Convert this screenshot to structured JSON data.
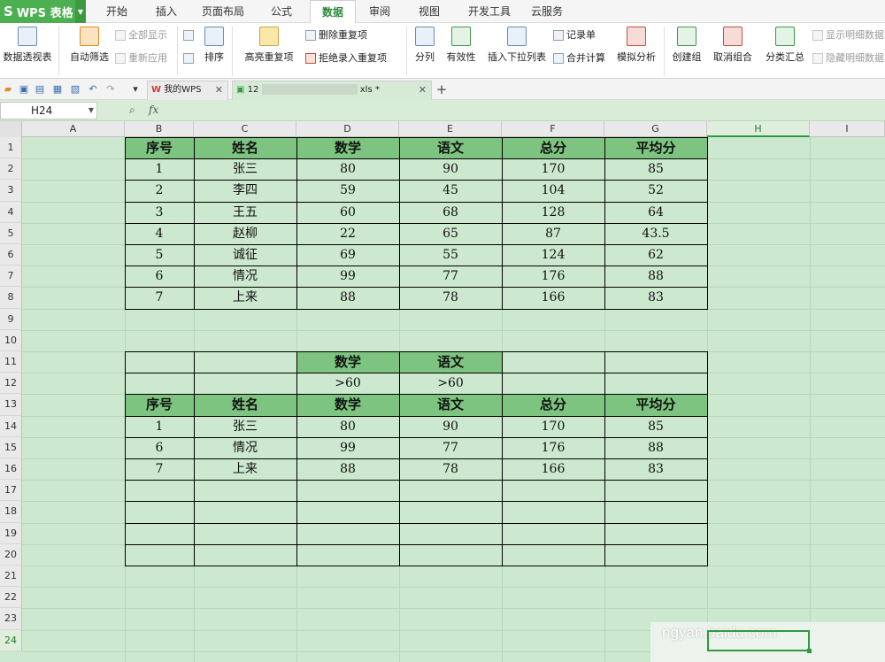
{
  "app": {
    "name": "WPS 表格",
    "logo_glyph": "S"
  },
  "menu_tabs": [
    "开始",
    "插入",
    "页面布局",
    "公式",
    "数据",
    "审阅",
    "视图",
    "开发工具",
    "云服务"
  ],
  "active_menu_tab": "数据",
  "ribbon": {
    "pivot": "数据透视表",
    "autofilter": "自动筛选",
    "show_all": "全部显示",
    "reapply": "重新应用",
    "sort": "排序",
    "highlight_dup": "高亮重复项",
    "remove_dup": "删除重复项",
    "reject_dup": "拒绝录入重复项",
    "split": "分列",
    "validity": "有效性",
    "insert_dropdown": "插入下拉列表",
    "record_form": "记录单",
    "consolidate": "合并计算",
    "what_if": "模拟分析",
    "create_group": "创建组",
    "ungroup": "取消组合",
    "subtotal": "分类汇总",
    "show_detail": "显示明细数据",
    "hide_detail": "隐藏明细数据"
  },
  "doc_tabs": [
    {
      "label": "我的WPS",
      "active": false
    },
    {
      "label": "12",
      "suffix": "xls *",
      "active": true
    }
  ],
  "formula_bar": {
    "name_box": "H24",
    "fx": "fx",
    "value": ""
  },
  "columns": [
    "A",
    "B",
    "C",
    "D",
    "E",
    "F",
    "G",
    "H",
    "I"
  ],
  "selected_column": "H",
  "rows": [
    "1",
    "2",
    "3",
    "4",
    "5",
    "6",
    "7",
    "8",
    "9",
    "10",
    "11",
    "12",
    "13",
    "14",
    "15",
    "16",
    "17",
    "18",
    "19",
    "20",
    "21",
    "22",
    "23",
    "24"
  ],
  "selected_row": "24",
  "table1": {
    "headers": [
      "序号",
      "姓名",
      "数学",
      "语文",
      "总分",
      "平均分"
    ],
    "rows": [
      [
        "1",
        "张三",
        "80",
        "90",
        "170",
        "85"
      ],
      [
        "2",
        "李四",
        "59",
        "45",
        "104",
        "52"
      ],
      [
        "3",
        "王五",
        "60",
        "68",
        "128",
        "64"
      ],
      [
        "4",
        "赵柳",
        "22",
        "65",
        "87",
        "43.5"
      ],
      [
        "5",
        "诚征",
        "69",
        "55",
        "124",
        "62"
      ],
      [
        "6",
        "情况",
        "99",
        "77",
        "176",
        "88"
      ],
      [
        "7",
        "上来",
        "88",
        "78",
        "166",
        "83"
      ]
    ]
  },
  "criteria": {
    "headers": [
      "",
      "",
      "数学",
      "语文",
      "",
      ""
    ],
    "values": [
      "",
      "",
      ">60",
      ">60",
      "",
      ""
    ]
  },
  "table2": {
    "headers": [
      "序号",
      "姓名",
      "数学",
      "语文",
      "总分",
      "平均分"
    ],
    "rows": [
      [
        "1",
        "张三",
        "80",
        "90",
        "170",
        "85"
      ],
      [
        "6",
        "情况",
        "99",
        "77",
        "176",
        "88"
      ],
      [
        "7",
        "上来",
        "88",
        "78",
        "166",
        "83"
      ],
      [
        "",
        "",
        "",
        "",
        "",
        ""
      ],
      [
        "",
        "",
        "",
        "",
        "",
        ""
      ],
      [
        "",
        "",
        "",
        "",
        "",
        ""
      ],
      [
        "",
        "",
        "",
        "",
        "",
        ""
      ]
    ]
  },
  "watermark": "ngyan.baidu.com",
  "colors": {
    "accent": "#4caf50",
    "header_fill": "#7cc47f",
    "sheet_bg": "#cce8cf"
  }
}
